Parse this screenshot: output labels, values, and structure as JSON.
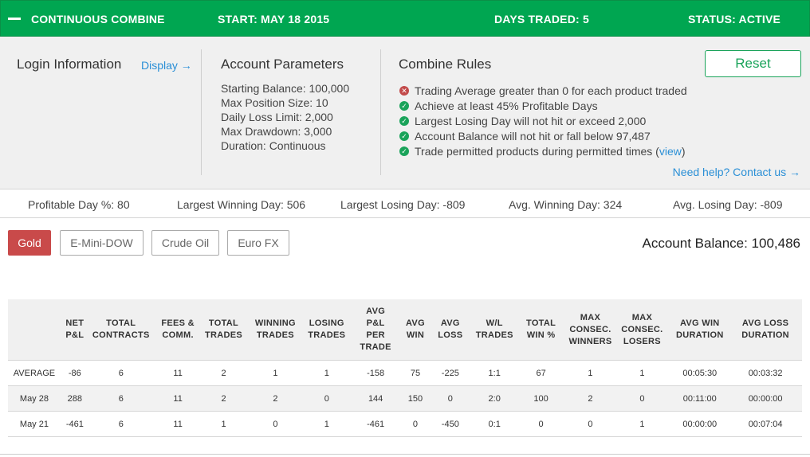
{
  "banner": {
    "title": "CONTINUOUS COMBINE",
    "start": "START: MAY 18 2015",
    "days_traded": "DAYS TRADED: 5",
    "status": "STATUS: ACTIVE",
    "color": "#00a651"
  },
  "login": {
    "title": "Login Information",
    "display_link": "Display →"
  },
  "account_params": {
    "title": "Account Parameters",
    "items": [
      "Starting Balance: 100,000",
      "Max Position Size: 10",
      "Daily Loss Limit: 2,000",
      "Max Drawdown: 3,000",
      "Duration: Continuous"
    ]
  },
  "rules": {
    "title": "Combine Rules",
    "items": [
      {
        "text": "Trading Average greater than 0 for each product traded",
        "status": "fail",
        "icon": "x-circle-icon"
      },
      {
        "text": "Achieve at least 45% Profitable Days",
        "status": "pass",
        "icon": "check-circle-icon"
      },
      {
        "text": "Largest Losing Day will not hit or exceed 2,000",
        "status": "pass",
        "icon": "check-circle-icon"
      },
      {
        "text": "Account Balance will not hit or fall below 97,487",
        "status": "pass",
        "icon": "check-circle-icon"
      },
      {
        "text": "Trade permitted products during permitted times (",
        "link": "view",
        "tail": ")",
        "status": "pass",
        "icon": "check-circle-icon"
      }
    ],
    "help_link": "Need help? Contact us →"
  },
  "reset_label": "Reset",
  "stats": [
    "Profitable Day %: 80",
    "Largest Winning Day: 506",
    "Largest Losing Day: -809",
    "Avg. Winning Day: 324",
    "Avg. Losing Day: -809"
  ],
  "products": {
    "tabs": [
      "Gold",
      "E-Mini-DOW",
      "Crude Oil",
      "Euro FX"
    ],
    "active": "Gold",
    "active_color": "#c94a4a"
  },
  "account_balance": "Account Balance: 100,486",
  "table": {
    "headers": [
      "",
      "NET P&L",
      "TOTAL CONTRACTS",
      "FEES & COMM.",
      "TOTAL TRADES",
      "WINNING TRADES",
      "LOSING TRADES",
      "AVG P&L PER TRADE",
      "AVG WIN",
      "AVG LOSS",
      "W/L TRADES",
      "TOTAL WIN %",
      "MAX CONSEC. WINNERS",
      "MAX CONSEC. LOSERS",
      "AVG WIN DURATION",
      "AVG LOSS DURATION"
    ],
    "rows": [
      [
        "AVERAGE",
        "-86",
        "6",
        "11",
        "2",
        "1",
        "1",
        "-158",
        "75",
        "-225",
        "1:1",
        "67",
        "1",
        "1",
        "00:05:30",
        "00:03:32"
      ],
      [
        "May 28",
        "288",
        "6",
        "11",
        "2",
        "2",
        "0",
        "144",
        "150",
        "0",
        "2:0",
        "100",
        "2",
        "0",
        "00:11:00",
        "00:00:00"
      ],
      [
        "May 21",
        "-461",
        "6",
        "11",
        "1",
        "0",
        "1",
        "-461",
        "0",
        "-450",
        "0:1",
        "0",
        "0",
        "1",
        "00:00:00",
        "00:07:04"
      ]
    ]
  }
}
